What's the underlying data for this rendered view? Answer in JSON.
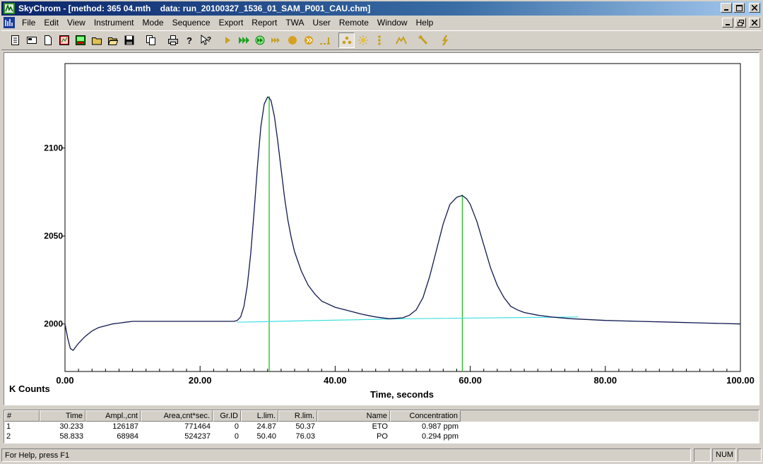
{
  "window": {
    "title": "SkyChrom - [method: 365 04.mth    data: run_20100327_1536_01_SAM_P001_CAU.chm]"
  },
  "menu": [
    "File",
    "Edit",
    "View",
    "Instrument",
    "Mode",
    "Sequence",
    "Export",
    "Report",
    "TWA",
    "User",
    "Remote",
    "Window",
    "Help"
  ],
  "toolbar": {
    "buttons": [
      "new-doc",
      "open-method",
      "blank-page",
      "chart-view",
      "image-view",
      "open-folder",
      "open-file",
      "save",
      "copy",
      "print",
      "help",
      "context-help",
      "run-single",
      "run-sequence",
      "run-sequence-alt",
      "fast-forward",
      "stop",
      "pause",
      "step",
      "peak-detect",
      "baseline",
      "vertical-dots",
      "mountain",
      "wrench",
      "pointer"
    ]
  },
  "chart_data": {
    "type": "line",
    "xlabel": "Time, seconds",
    "ylabel": "K Counts",
    "xlim": [
      0,
      100
    ],
    "ylim": [
      1973,
      2148
    ],
    "x_ticks": [
      "0.00",
      "20.00",
      "40.00",
      "60.00",
      "80.00",
      "100.00"
    ],
    "y_ticks": [
      "2000",
      "2050",
      "2100"
    ],
    "series": [
      {
        "color": "#101850",
        "x": [
          0,
          0.4,
          0.8,
          1.2,
          2,
          3,
          4,
          5,
          6,
          7,
          8,
          9,
          10,
          12,
          14,
          16,
          18,
          20,
          22,
          24,
          25,
          25.5,
          26,
          26.5,
          27,
          27.5,
          28,
          28.5,
          29,
          29.5,
          30,
          30.233,
          30.5,
          31,
          31.5,
          32,
          32.5,
          33,
          33.5,
          34,
          35,
          36,
          37,
          38,
          40,
          42,
          44,
          46,
          48,
          50,
          51,
          52,
          53,
          54,
          55,
          56,
          57,
          58,
          58.833,
          59.5,
          60,
          61,
          62,
          63,
          64,
          65,
          66,
          67,
          68,
          70,
          72,
          75,
          80,
          85,
          90,
          95,
          100
        ],
        "y": [
          2000,
          1992,
          1986,
          1985,
          1989,
          1993,
          1996,
          1998,
          1999,
          2000,
          2000.5,
          2001,
          2001.5,
          2001.5,
          2001.5,
          2001.5,
          2001.5,
          2001.5,
          2001.5,
          2001.5,
          2001.5,
          2002,
          2004,
          2010,
          2022,
          2040,
          2064,
          2090,
          2112,
          2125,
          2129,
          2128.5,
          2127,
          2118,
          2104,
          2088,
          2072,
          2059,
          2049,
          2041,
          2030,
          2022,
          2017,
          2013,
          2009.5,
          2007.5,
          2005.5,
          2004,
          2003,
          2003.5,
          2005,
          2008,
          2015,
          2027,
          2042,
          2057,
          2068,
          2072,
          2073,
          2071,
          2068,
          2058,
          2045,
          2032,
          2022,
          2015,
          2010,
          2008,
          2006.5,
          2005,
          2004,
          2003,
          2002,
          2001.5,
          2001,
          2000.5,
          2000
        ]
      },
      {
        "color": "#40e0e0",
        "x": [
          25.5,
          50.4,
          76
        ],
        "y": [
          2001,
          2003,
          2004
        ]
      }
    ],
    "peak_markers": [
      30.233,
      58.833
    ],
    "marker_color": "#20c020"
  },
  "results": {
    "columns": [
      "#",
      "Time",
      "Ampl.,cnt",
      "Area,cnt*sec.",
      "Gr.ID",
      "L.lim.",
      "R.lim.",
      "Name",
      "Concentration"
    ],
    "rows": [
      [
        "1",
        "30.233",
        "126187",
        "771464",
        "0",
        "24.87",
        "50.37",
        "ETO",
        "0.987 ppm"
      ],
      [
        "2",
        "58.833",
        "68984",
        "524237",
        "0",
        "50.40",
        "76.03",
        "PO",
        "0.294 ppm"
      ]
    ]
  },
  "status": {
    "help_text": "For Help, press F1",
    "indicator": "NUM"
  }
}
